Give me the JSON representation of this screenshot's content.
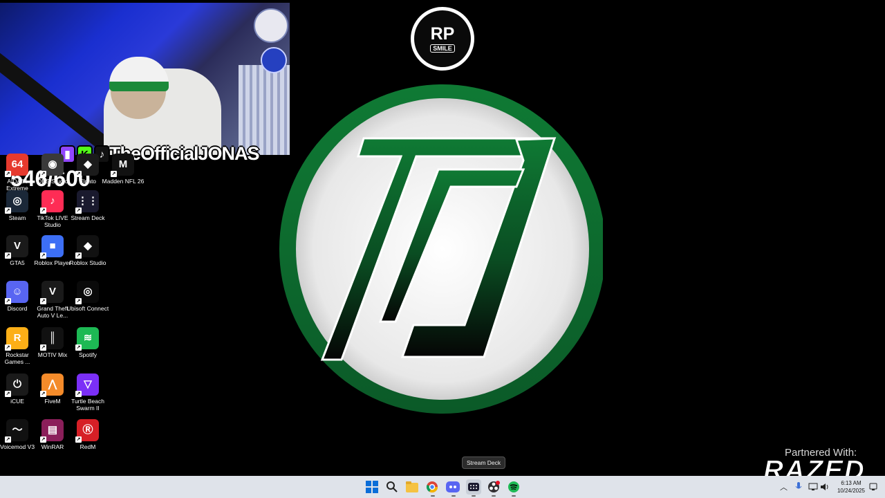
{
  "overlay": {
    "stream_name": "TheOfficialJONAS",
    "goal": "546/600",
    "socials": [
      "twitch-icon",
      "kick-icon",
      "tiktok-icon"
    ]
  },
  "desktop_icons": [
    {
      "name": "AIDA64 Extreme",
      "label": "AIDA64 Extreme",
      "icon": "aida64-icon",
      "color": "#e63a2e"
    },
    {
      "name": "OBS Studio",
      "label": "OBS Studio",
      "icon": "obs-icon",
      "color": "#3a3a3a"
    },
    {
      "name": "Elgato",
      "label": "Elgato",
      "icon": "elgato-icon",
      "color": "#1b1b1b"
    },
    {
      "name": "Madden NFL 26",
      "label": "Madden NFL 26",
      "icon": "madden-icon",
      "color": "#111111"
    },
    {
      "name": "Steam",
      "label": "Steam",
      "icon": "steam-icon",
      "color": "#1b2838"
    },
    {
      "name": "TikTok LIVE Studio",
      "label": "TikTok LIVE Studio",
      "icon": "tiktok-live-icon",
      "color": "#fe2c55"
    },
    {
      "name": "Stream Deck",
      "label": "Stream Deck",
      "icon": "stream-deck-icon",
      "color": "#1a1a2e"
    },
    {
      "name": "GTA5",
      "label": "GTA5",
      "icon": "gta5-icon",
      "color": "#1a1a1a"
    },
    {
      "name": "Roblox Player",
      "label": "Roblox Player",
      "icon": "roblox-icon",
      "color": "#3d6ff5"
    },
    {
      "name": "Roblox Studio",
      "label": "Roblox Studio",
      "icon": "roblox-studio-icon",
      "color": "#111111"
    },
    {
      "name": "Discord",
      "label": "Discord",
      "icon": "discord-icon",
      "color": "#5865f2"
    },
    {
      "name": "Grand Theft Auto V Le...",
      "label": "Grand Theft Auto V Le...",
      "icon": "gta-legacy-icon",
      "color": "#1a1a1a"
    },
    {
      "name": "Ubisoft Connect",
      "label": "Ubisoft Connect",
      "icon": "ubisoft-icon",
      "color": "#0a0a0a"
    },
    {
      "name": "Rockstar Games ...",
      "label": "Rockstar Games ...",
      "icon": "rockstar-icon",
      "color": "#fcaf17"
    },
    {
      "name": "MOTIV Mix",
      "label": "MOTIV Mix",
      "icon": "motiv-mix-icon",
      "color": "#111111"
    },
    {
      "name": "Spotify",
      "label": "Spotify",
      "icon": "spotify-icon",
      "color": "#1db954"
    },
    {
      "name": "iCUE",
      "label": "iCUE",
      "icon": "icue-icon",
      "color": "#1a1a1a"
    },
    {
      "name": "FiveM",
      "label": "FiveM",
      "icon": "fivem-icon",
      "color": "#f48b2a"
    },
    {
      "name": "Turtle Beach Swarm II",
      "label": "Turtle Beach Swarm II",
      "icon": "turtle-beach-icon",
      "color": "#7b2ff7"
    },
    {
      "name": "Voicemod V3",
      "label": "Voicemod V3",
      "icon": "voicemod-icon",
      "color": "#111111"
    },
    {
      "name": "WinRAR",
      "label": "WinRAR",
      "icon": "winrar-icon",
      "color": "#8b1f5a"
    },
    {
      "name": "RedM",
      "label": "RedM",
      "icon": "redm-icon",
      "color": "#d61f26"
    }
  ],
  "logos": {
    "rp_text": "RP",
    "rp_sub": "SMILE",
    "brand_green": "#0f7a34"
  },
  "partner": {
    "label": "Partnered With:",
    "brand": "RAZED"
  },
  "tooltip": "Stream Deck",
  "taskbar": {
    "apps": [
      "windows-start-icon",
      "search-icon",
      "file-explorer-icon",
      "chrome-icon",
      "discord-icon",
      "stream-deck-icon",
      "obs-icon",
      "spotify-icon"
    ],
    "time": "6:13 AM",
    "date": "10/24/2025"
  }
}
